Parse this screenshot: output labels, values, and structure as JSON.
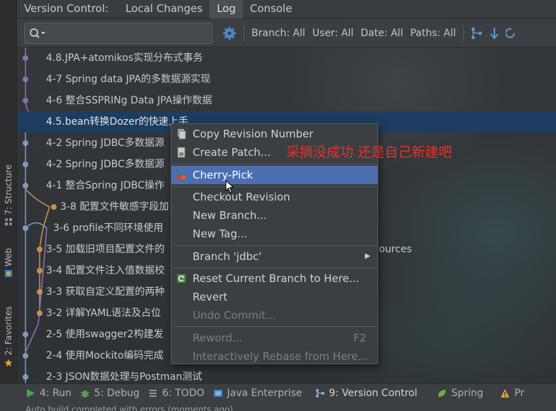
{
  "tabs": {
    "prefix": "Version Control:",
    "items": [
      "Local Changes",
      "Log",
      "Console"
    ],
    "active": "Log"
  },
  "toolbar": {
    "search_placeholder": "",
    "branch": "Branch: All",
    "user": "User: All",
    "date": "Date: All",
    "paths": "Paths: All"
  },
  "side_tabs": {
    "structure": "7: Structure",
    "web": "Web",
    "favorites": "2: Favorites"
  },
  "commits": [
    {
      "message": "4.8.JPA+atomikos实现分布式事务"
    },
    {
      "message": "4-7 Spring data JPA的多数据源实现"
    },
    {
      "message": "4-6 整合SSPRINg Data JPA操作数据"
    },
    {
      "message": "4.5.bean转换Dozer的快速上手",
      "selected": true
    },
    {
      "message": "4-2 Spring JDBC多数据源"
    },
    {
      "message": "4-2 Spring JDBC多数据源"
    },
    {
      "message": "4-1 整合Spring JDBC操作"
    },
    {
      "message": "3-8 配置文件敏感字段加"
    },
    {
      "message": "3-6 profile不同环境使用"
    },
    {
      "message": "3-5 加载旧项目配置文件的",
      "tail": "ources"
    },
    {
      "message": "3-4 配置文件注入值数据校"
    },
    {
      "message": "3-3 获取自定义配置的两种"
    },
    {
      "message": "3-2 详解YAML语法及占位"
    },
    {
      "message": "2-5 使用swagger2构建发"
    },
    {
      "message": "2-4 使用Mockito编码完成"
    },
    {
      "message": "2-3 JSON数据处理与Postman测试"
    }
  ],
  "context_menu": {
    "items": [
      {
        "label": "Copy Revision Number",
        "icon": "copy-icon"
      },
      {
        "label": "Create Patch...",
        "icon": "patch-icon"
      },
      {
        "label": "Cherry-Pick",
        "icon": "cherry-icon",
        "highlighted": true
      },
      {
        "label": "Checkout Revision"
      },
      {
        "label": "New Branch..."
      },
      {
        "label": "New Tag..."
      },
      {
        "label": "Branch 'jdbc'",
        "submenu": true
      },
      {
        "label": "Reset Current Branch to Here...",
        "icon": "reset-icon"
      },
      {
        "label": "Revert"
      },
      {
        "label": "Undo Commit...",
        "disabled": true
      },
      {
        "label": "Reword...",
        "shortcut": "F2",
        "disabled": true
      },
      {
        "label": "Interactively Rebase from Here...",
        "disabled": true
      }
    ]
  },
  "annotation": "采摘没成功   还是自己新建吧",
  "bottom_tools": [
    {
      "label": "4: Run",
      "icon": "run-icon"
    },
    {
      "label": "5: Debug",
      "icon": "debug-icon"
    },
    {
      "label": "6: TODO",
      "icon": "todo-icon"
    },
    {
      "label": "Java Enterprise",
      "icon": "java-enterprise-icon"
    },
    {
      "label": "9: Version Control",
      "icon": "version-control-icon",
      "active": true
    },
    {
      "label": "Spring",
      "icon": "spring-icon"
    },
    {
      "label": "Pr",
      "icon": "warning-icon"
    }
  ],
  "status_text": "Auto build completed with errors (moments ago)",
  "colors": {
    "accent": "#4b6eaf",
    "selection": "#1d3d60",
    "annotation": "#e0342f",
    "graph_purple": "#8c6fb0",
    "graph_orange": "#c89050",
    "graph_blue": "#7a9cc4"
  }
}
